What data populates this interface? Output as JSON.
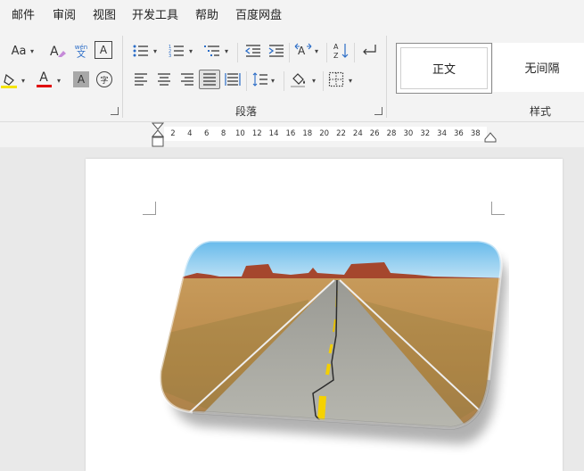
{
  "menu": {
    "items": [
      "邮件",
      "审阅",
      "视图",
      "开发工具",
      "帮助",
      "百度网盘"
    ]
  },
  "ribbon": {
    "font": {
      "change_case_label": "Aa",
      "phonetic_top": "wén",
      "phonetic_bottom": "文",
      "char_border_label": "A",
      "font_color_label": "A",
      "char_shading_label": "A",
      "enclose_char_label": "字",
      "highlight_color": "#f5e400",
      "font_color": "#e00000"
    },
    "paragraph": {
      "group_label": "段落"
    },
    "styles": {
      "group_label": "样式",
      "items": [
        "正文",
        "无间隔"
      ]
    }
  },
  "ruler": {
    "ticks": [
      "2",
      "4",
      "6",
      "8",
      "10",
      "12",
      "14",
      "16",
      "18",
      "20",
      "22",
      "24",
      "26",
      "28",
      "30",
      "32",
      "34",
      "36",
      "38"
    ]
  },
  "document": {
    "image_description": "desert highway photo with rounded bevel frame"
  }
}
